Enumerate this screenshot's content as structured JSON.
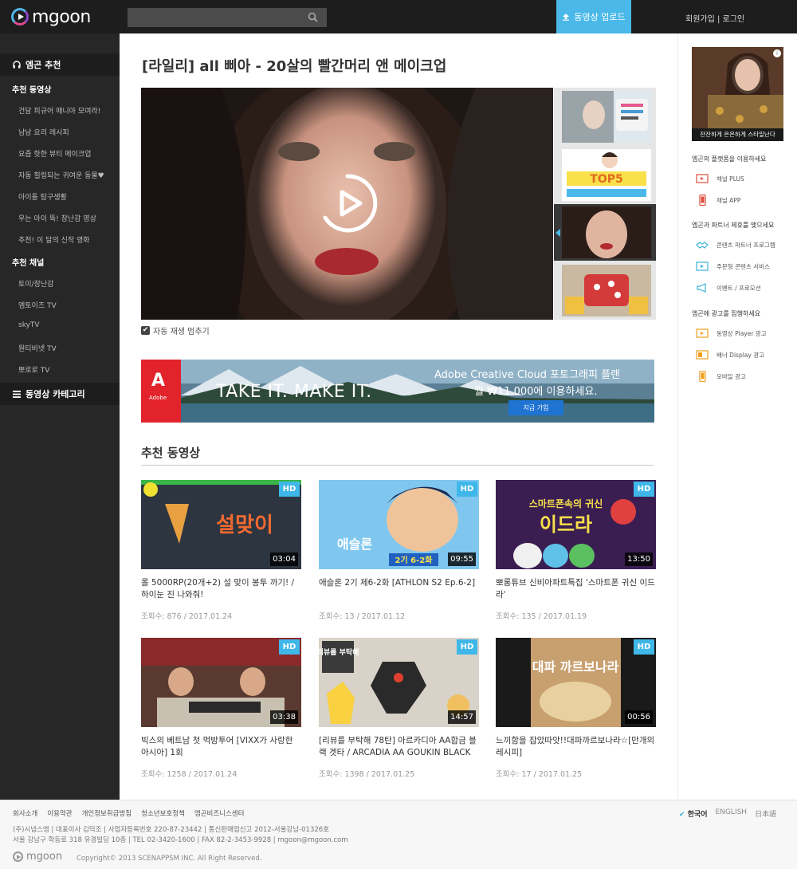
{
  "header": {
    "logo": "mgoon",
    "upload": "동영상 업로드",
    "auth": "회원가입 | 로그인"
  },
  "sidebar": {
    "recommend_head": "엠곤 추천",
    "section1": "추천 동영상",
    "items1": [
      "건담 피규어 매니아 모여라!",
      "남남 요리 레시피",
      "요즘 핫한 뷰티 메이크업",
      "자동 힐링되는 귀여운 동물♥",
      "아이돌 탐구생활",
      "우는 아이 뚝! 장난감 영상",
      "추천! 이 달의 신작 영화"
    ],
    "section2": "추천 채널",
    "items2": [
      "토이/장난감",
      "엠토이즈 TV",
      "skyTV",
      "원티비넷 TV",
      "뽀로로 TV"
    ],
    "category_head": "동영상 카테고리"
  },
  "main": {
    "title": "[라일리] all 삐아 - 20살의 빨간머리 앤 메이크업",
    "autoplay": "자동 재생 멈추기",
    "banner": {
      "brand": "Adobe",
      "tagline": "TAKE IT. MAKE IT.",
      "line1": "Adobe Creative Cloud 포토그래피 플랜",
      "line2": "월 ₩11,000에 이용하세요.",
      "button": "지금 가입"
    },
    "section_title": "추천 동영상",
    "videos": [
      {
        "title": "롤 5000RP(20개+2) 설 맞이 봉투 까기! / 하이눈 진 나와줘!",
        "views": "조회수: 876",
        "date": "/ 2017.01.24",
        "duration": "03:04",
        "hd": "HD"
      },
      {
        "title": "애슬론 2기 제6-2화 [ATHLON S2 Ep.6-2]",
        "views": "조회수: 13",
        "date": "/ 2017.01.12",
        "duration": "09:55",
        "hd": "HD"
      },
      {
        "title": "뽀롱튜브 신비아파트특집 '스마트폰 귀신 이드라'",
        "views": "조회수: 135",
        "date": "/ 2017.01.19",
        "duration": "13:50",
        "hd": "HD"
      },
      {
        "title": "빅스의 베트남 첫 먹방투어 [VIXX가 사랑한 아시아] 1회",
        "views": "조회수: 1258",
        "date": "/ 2017.01.24",
        "duration": "03:38",
        "hd": "HD"
      },
      {
        "title": "[리뷰를 부탁해 78탄] 아르카디아 AA합금 블랙 겟타 / ARCADIA AA GOUKIN BLACK",
        "views": "조회수: 1398",
        "date": "/ 2017.01.25",
        "duration": "14:57",
        "hd": "HD"
      },
      {
        "title": "느끼함을 잡았따앗!!대파까르보나라☆[만개의레시피]",
        "views": "조회수: 17",
        "date": "/ 2017.01.25",
        "duration": "00:56",
        "hd": "HD"
      }
    ],
    "thumb_text": {
      "v1": "설맞이",
      "v2": "애슬론",
      "v2b": "2기 6-2화",
      "v3a": "스마트폰속의 귀신",
      "v3b": "이드라",
      "v5": "리뷰를 부탁해",
      "v6": "대파 까르보나라"
    }
  },
  "rail": {
    "ad_caption": "잔잔하게 은은하게 스타일난다",
    "sec1": "엠곤의 플랫폼을 이용하세요",
    "items1": [
      "채널 PLUS",
      "채널 APP"
    ],
    "sec2": "엠곤과 파트너 제휴를 맺으세요",
    "items2": [
      "콘텐츠 파트너 프로그램",
      "주문형 콘텐츠 서비스",
      "이벤트 / 프로모션"
    ],
    "sec3": "엠곤에 광고를 집행하세요",
    "items3": [
      "동영상 Player 광고",
      "배너 Display 광고",
      "모바일 광고"
    ]
  },
  "footer": {
    "links": [
      "회사소개",
      "이용약관",
      "개인정보취급방침",
      "청소년보호정책",
      "엠곤비즈니스센터"
    ],
    "info1": "(주)시냅스엠 | 대표이사 김덕조 | 사업자등록번호 220-87-23442 | 통신판매업신고 2012-서울강남-01326호",
    "info2": "서울 강남구 학동로 318 유경빌딩 10층 | TEL 02-3420-1600 | FAX 82-2-3453-9928 | mgoon@mgoon.com",
    "langs": [
      "한국어",
      "ENGLISH",
      "日本語"
    ],
    "copyright": "Copyright© 2013 SCENAPPSM INC. All Right Reserved.",
    "logo": "mgoon"
  }
}
